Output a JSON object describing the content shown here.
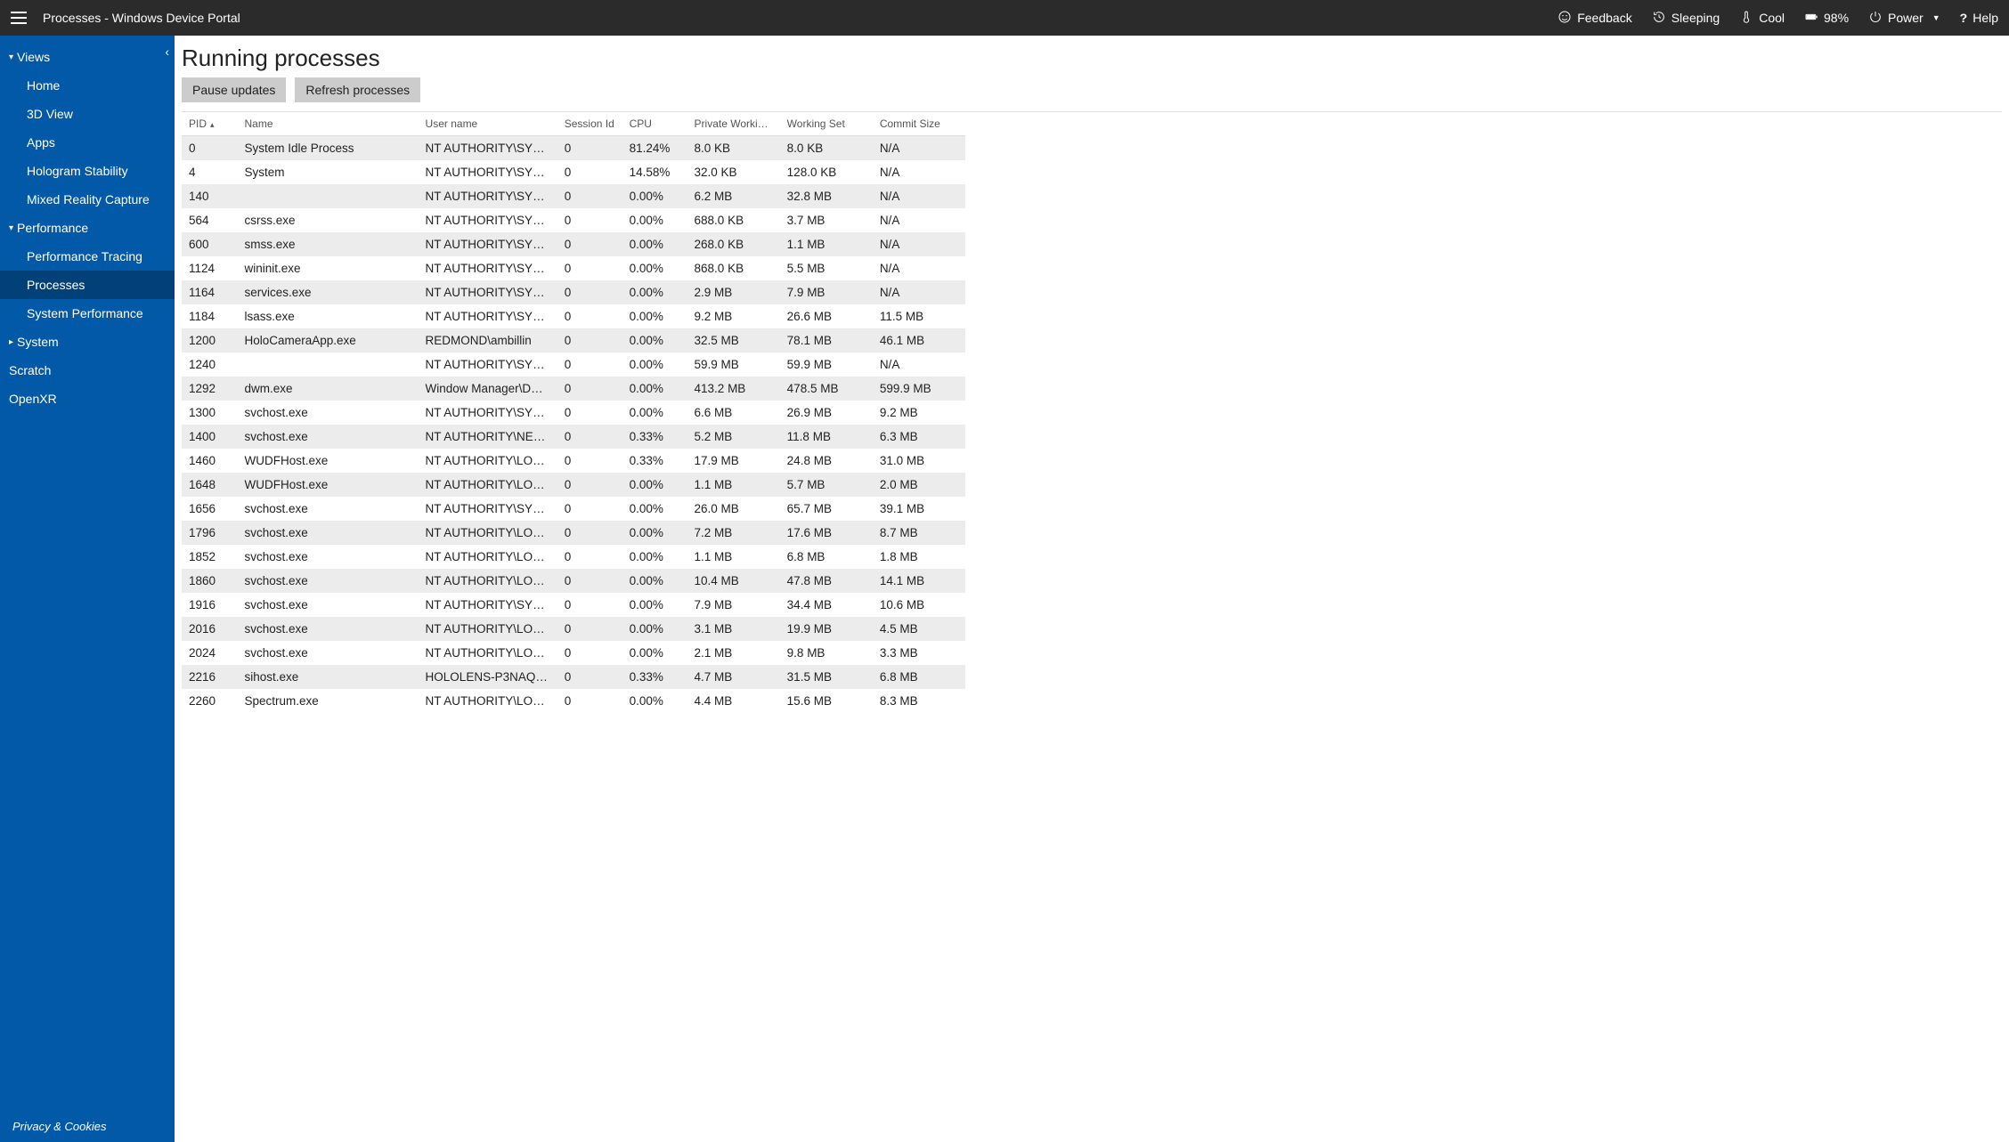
{
  "topbar": {
    "title": "Processes - Windows Device Portal",
    "feedback": "Feedback",
    "sleep_state": "Sleeping",
    "temp_state": "Cool",
    "battery": "98%",
    "power": "Power",
    "help": "Help"
  },
  "sidebar": {
    "groups": [
      {
        "label": "Views",
        "expanded": true,
        "items": [
          {
            "label": "Home"
          },
          {
            "label": "3D View"
          },
          {
            "label": "Apps"
          },
          {
            "label": "Hologram Stability"
          },
          {
            "label": "Mixed Reality Capture"
          }
        ]
      },
      {
        "label": "Performance",
        "expanded": true,
        "items": [
          {
            "label": "Performance Tracing"
          },
          {
            "label": "Processes",
            "active": true
          },
          {
            "label": "System Performance"
          }
        ]
      },
      {
        "label": "System",
        "expanded": false,
        "items": []
      }
    ],
    "loose_items": [
      {
        "label": "Scratch"
      },
      {
        "label": "OpenXR"
      }
    ],
    "footer": "Privacy & Cookies"
  },
  "page": {
    "title": "Running processes",
    "pause_btn": "Pause updates",
    "refresh_btn": "Refresh processes"
  },
  "table": {
    "columns": [
      "PID",
      "Name",
      "User name",
      "Session Id",
      "CPU",
      "Private Working Set",
      "Working Set",
      "Commit Size"
    ],
    "sort_col": 0,
    "rows": [
      {
        "pid": "0",
        "name": "System Idle Process",
        "user": "NT AUTHORITY\\SYSTEM",
        "sess": "0",
        "cpu": "81.24%",
        "pws": "8.0 KB",
        "ws": "8.0 KB",
        "cs": "N/A"
      },
      {
        "pid": "4",
        "name": "System",
        "user": "NT AUTHORITY\\SYSTEM",
        "sess": "0",
        "cpu": "14.58%",
        "pws": "32.0 KB",
        "ws": "128.0 KB",
        "cs": "N/A"
      },
      {
        "pid": "140",
        "name": "",
        "user": "NT AUTHORITY\\SYSTEM",
        "sess": "0",
        "cpu": "0.00%",
        "pws": "6.2 MB",
        "ws": "32.8 MB",
        "cs": "N/A"
      },
      {
        "pid": "564",
        "name": "csrss.exe",
        "user": "NT AUTHORITY\\SYSTEM",
        "sess": "0",
        "cpu": "0.00%",
        "pws": "688.0 KB",
        "ws": "3.7 MB",
        "cs": "N/A"
      },
      {
        "pid": "600",
        "name": "smss.exe",
        "user": "NT AUTHORITY\\SYSTEM",
        "sess": "0",
        "cpu": "0.00%",
        "pws": "268.0 KB",
        "ws": "1.1 MB",
        "cs": "N/A"
      },
      {
        "pid": "1124",
        "name": "wininit.exe",
        "user": "NT AUTHORITY\\SYSTEM",
        "sess": "0",
        "cpu": "0.00%",
        "pws": "868.0 KB",
        "ws": "5.5 MB",
        "cs": "N/A"
      },
      {
        "pid": "1164",
        "name": "services.exe",
        "user": "NT AUTHORITY\\SYSTEM",
        "sess": "0",
        "cpu": "0.00%",
        "pws": "2.9 MB",
        "ws": "7.9 MB",
        "cs": "N/A"
      },
      {
        "pid": "1184",
        "name": "lsass.exe",
        "user": "NT AUTHORITY\\SYSTEM",
        "sess": "0",
        "cpu": "0.00%",
        "pws": "9.2 MB",
        "ws": "26.6 MB",
        "cs": "11.5 MB"
      },
      {
        "pid": "1200",
        "name": "HoloCameraApp.exe",
        "user": "REDMOND\\ambillin",
        "sess": "0",
        "cpu": "0.00%",
        "pws": "32.5 MB",
        "ws": "78.1 MB",
        "cs": "46.1 MB"
      },
      {
        "pid": "1240",
        "name": "",
        "user": "NT AUTHORITY\\SYSTEM",
        "sess": "0",
        "cpu": "0.00%",
        "pws": "59.9 MB",
        "ws": "59.9 MB",
        "cs": "N/A"
      },
      {
        "pid": "1292",
        "name": "dwm.exe",
        "user": "Window Manager\\DWM…",
        "sess": "0",
        "cpu": "0.00%",
        "pws": "413.2 MB",
        "ws": "478.5 MB",
        "cs": "599.9 MB"
      },
      {
        "pid": "1300",
        "name": "svchost.exe",
        "user": "NT AUTHORITY\\SYSTEM",
        "sess": "0",
        "cpu": "0.00%",
        "pws": "6.6 MB",
        "ws": "26.9 MB",
        "cs": "9.2 MB"
      },
      {
        "pid": "1400",
        "name": "svchost.exe",
        "user": "NT AUTHORITY\\NETWO…",
        "sess": "0",
        "cpu": "0.33%",
        "pws": "5.2 MB",
        "ws": "11.8 MB",
        "cs": "6.3 MB"
      },
      {
        "pid": "1460",
        "name": "WUDFHost.exe",
        "user": "NT AUTHORITY\\LOCAL …",
        "sess": "0",
        "cpu": "0.33%",
        "pws": "17.9 MB",
        "ws": "24.8 MB",
        "cs": "31.0 MB"
      },
      {
        "pid": "1648",
        "name": "WUDFHost.exe",
        "user": "NT AUTHORITY\\LOCAL …",
        "sess": "0",
        "cpu": "0.00%",
        "pws": "1.1 MB",
        "ws": "5.7 MB",
        "cs": "2.0 MB"
      },
      {
        "pid": "1656",
        "name": "svchost.exe",
        "user": "NT AUTHORITY\\SYSTEM",
        "sess": "0",
        "cpu": "0.00%",
        "pws": "26.0 MB",
        "ws": "65.7 MB",
        "cs": "39.1 MB"
      },
      {
        "pid": "1796",
        "name": "svchost.exe",
        "user": "NT AUTHORITY\\LOCAL …",
        "sess": "0",
        "cpu": "0.00%",
        "pws": "7.2 MB",
        "ws": "17.6 MB",
        "cs": "8.7 MB"
      },
      {
        "pid": "1852",
        "name": "svchost.exe",
        "user": "NT AUTHORITY\\LOCAL …",
        "sess": "0",
        "cpu": "0.00%",
        "pws": "1.1 MB",
        "ws": "6.8 MB",
        "cs": "1.8 MB"
      },
      {
        "pid": "1860",
        "name": "svchost.exe",
        "user": "NT AUTHORITY\\LOCAL …",
        "sess": "0",
        "cpu": "0.00%",
        "pws": "10.4 MB",
        "ws": "47.8 MB",
        "cs": "14.1 MB"
      },
      {
        "pid": "1916",
        "name": "svchost.exe",
        "user": "NT AUTHORITY\\SYSTEM",
        "sess": "0",
        "cpu": "0.00%",
        "pws": "7.9 MB",
        "ws": "34.4 MB",
        "cs": "10.6 MB"
      },
      {
        "pid": "2016",
        "name": "svchost.exe",
        "user": "NT AUTHORITY\\LOCAL …",
        "sess": "0",
        "cpu": "0.00%",
        "pws": "3.1 MB",
        "ws": "19.9 MB",
        "cs": "4.5 MB"
      },
      {
        "pid": "2024",
        "name": "svchost.exe",
        "user": "NT AUTHORITY\\LOCAL …",
        "sess": "0",
        "cpu": "0.00%",
        "pws": "2.1 MB",
        "ws": "9.8 MB",
        "cs": "3.3 MB"
      },
      {
        "pid": "2216",
        "name": "sihost.exe",
        "user": "HOLOLENS-P3NAQ6\\De…",
        "sess": "0",
        "cpu": "0.33%",
        "pws": "4.7 MB",
        "ws": "31.5 MB",
        "cs": "6.8 MB"
      },
      {
        "pid": "2260",
        "name": "Spectrum.exe",
        "user": "NT AUTHORITY\\LOCAL …",
        "sess": "0",
        "cpu": "0.00%",
        "pws": "4.4 MB",
        "ws": "15.6 MB",
        "cs": "8.3 MB"
      }
    ]
  }
}
